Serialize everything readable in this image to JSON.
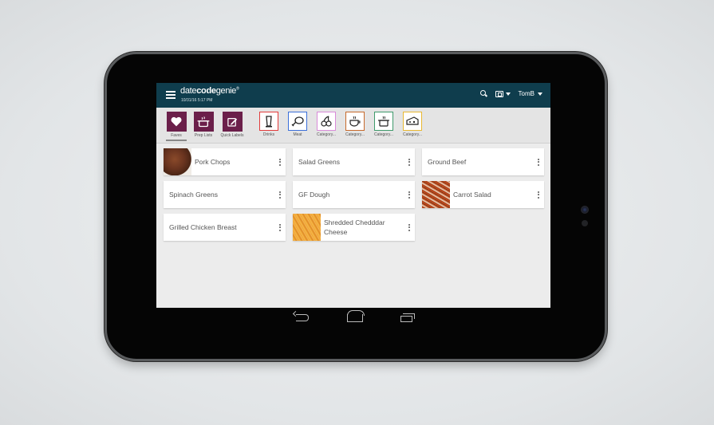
{
  "header": {
    "logo_light1": "date",
    "logo_bold": "code",
    "logo_light2": "genie",
    "logo_mark": "®",
    "datetime": "10/31/16   5:17 PM",
    "user": "TomB"
  },
  "toolbar": {
    "main": [
      {
        "label": "Faves",
        "icon": "heart-icon",
        "active": true
      },
      {
        "label": "Prep Lists",
        "icon": "pot-icon"
      },
      {
        "label": "Quick Labels",
        "icon": "edit-icon"
      }
    ],
    "categories": [
      {
        "label": "Drinks",
        "icon": "drink-icon",
        "color": "#e23b3b"
      },
      {
        "label": "Meat",
        "icon": "drumstick-icon",
        "color": "#3b6fd9"
      },
      {
        "label": "Category...",
        "icon": "cherries-icon",
        "color": "#d98ad9"
      },
      {
        "label": "Category...",
        "icon": "coffee-cup-icon",
        "color": "#c76a2b"
      },
      {
        "label": "Category...",
        "icon": "cooking-pot-icon",
        "color": "#3f9a6b"
      },
      {
        "label": "Category...",
        "icon": "cheese-icon",
        "color": "#e8b832"
      }
    ]
  },
  "items": [
    {
      "name": "Pork Chops",
      "thumb": "pork"
    },
    {
      "name": "Salad Greens"
    },
    {
      "name": "Ground Beef"
    },
    {
      "name": "Spinach Greens"
    },
    {
      "name": "GF Dough"
    },
    {
      "name": "Carrot Salad",
      "thumb": "carrot"
    },
    {
      "name": "Grilled Chicken Breast"
    },
    {
      "name": "Shredded Chedddar Cheese",
      "thumb": "cheese"
    }
  ],
  "colors": {
    "header_bg": "#0f3d4d",
    "main_button_bg": "#6b1f4a"
  }
}
